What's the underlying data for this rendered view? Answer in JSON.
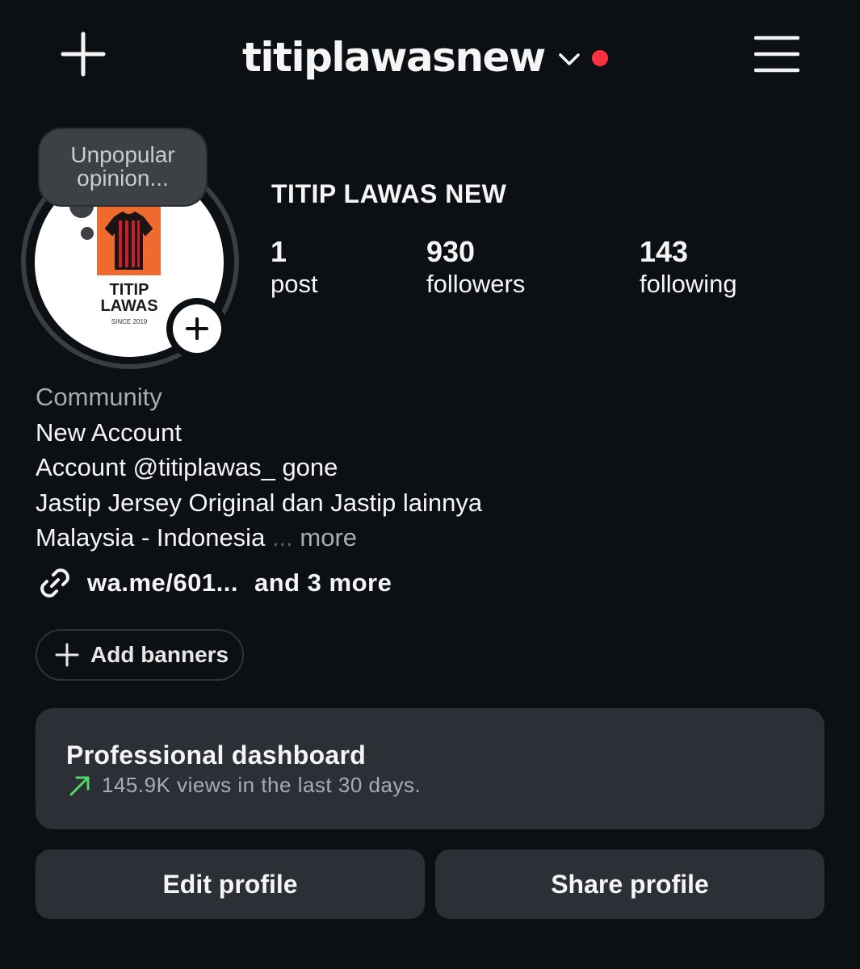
{
  "header": {
    "username": "titiplawasnew",
    "notification_dot_color": "#ff3040",
    "left_icon": "plus-icon",
    "right_icon": "menu-icon"
  },
  "avatar": {
    "note_text": "Unpopular opinion...",
    "logo_line1": "TITIP",
    "logo_line2": "LAWAS",
    "logo_line3": "SINCE 2019",
    "logo_color": "#ef6a2e"
  },
  "profile": {
    "display_name": "TITIP LAWAS NEW",
    "stats": [
      {
        "value": "1",
        "label": "post"
      },
      {
        "value": "930",
        "label": "followers"
      },
      {
        "value": "143",
        "label": "following"
      }
    ]
  },
  "bio": {
    "category": "Community",
    "lines": [
      "New Account",
      "Account @titiplawas_ gone",
      "Jastip Jersey Original dan Jastip lainnya",
      "Malaysia - Indonesia"
    ],
    "ellipsis": " ... ",
    "more_label": "more"
  },
  "links": {
    "primary": "wa.me/601...",
    "extra": "and 3 more"
  },
  "banners": {
    "label": "Add banners"
  },
  "dashboard": {
    "title": "Professional dashboard",
    "subtitle": "145.9K views in the last 30 days.",
    "trend_color": "#4cd964"
  },
  "actions": {
    "edit_label": "Edit profile",
    "share_label": "Share profile"
  }
}
